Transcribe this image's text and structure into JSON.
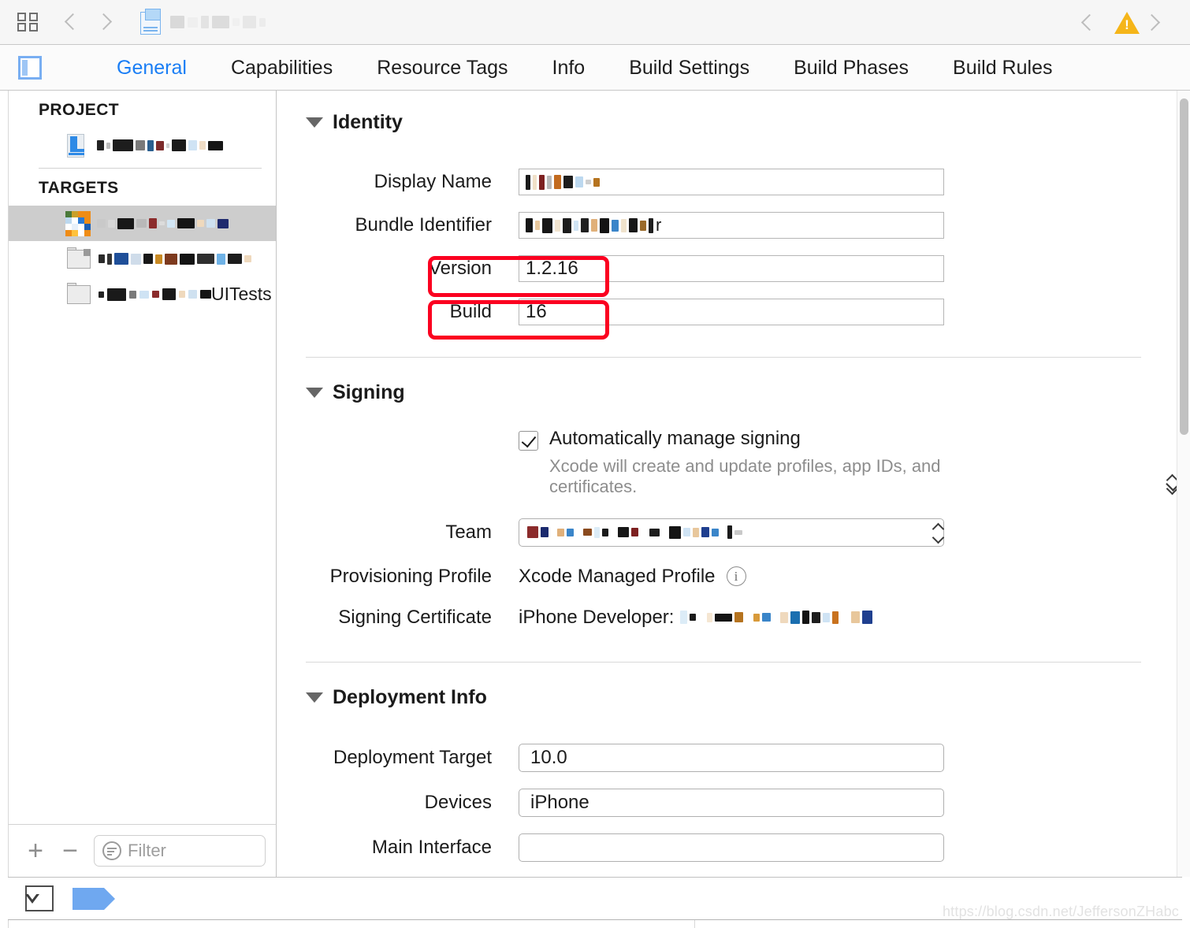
{
  "toolbar": {
    "grid_icon": "grid-icon",
    "back_label": "‹",
    "forward_label": "›",
    "breadcrumb_redacted": true,
    "warning_icon": "warning-triangle-icon"
  },
  "tabbar": {
    "sidebar_toggle": "sidebar-toggle-icon",
    "active_tab": "General",
    "tabs": [
      {
        "label": "General",
        "active": true
      },
      {
        "label": "Capabilities",
        "active": false
      },
      {
        "label": "Resource Tags",
        "active": false
      },
      {
        "label": "Info",
        "active": false
      },
      {
        "label": "Build Settings",
        "active": false
      },
      {
        "label": "Build Phases",
        "active": false
      },
      {
        "label": "Build Rules",
        "active": false
      }
    ]
  },
  "sidebar": {
    "project_header": "PROJECT",
    "targets_header": "TARGETS",
    "project_items": [
      {
        "name_visible": "",
        "redacted": true,
        "icon": "xcode-project-icon"
      }
    ],
    "target_items": [
      {
        "name_visible": "",
        "redacted": true,
        "icon": "app-icon",
        "selected": true
      },
      {
        "name_visible": "",
        "redacted": true,
        "icon": "test-bundle-icon",
        "selected": false
      },
      {
        "name_visible": "UITests",
        "redacted": true,
        "icon": "test-bundle-icon",
        "selected": false
      }
    ],
    "footer": {
      "add_label": "+",
      "remove_label": "−",
      "filter_placeholder": "Filter",
      "filter_value": ""
    }
  },
  "content": {
    "identity": {
      "title": "Identity",
      "fields": [
        {
          "label": "Display Name",
          "value": "",
          "redacted": true,
          "highlighted": false
        },
        {
          "label": "Bundle Identifier",
          "value": "",
          "redacted": true,
          "highlighted": false
        },
        {
          "label": "Version",
          "value": "1.2.16",
          "redacted": false,
          "highlighted": true
        },
        {
          "label": "Build",
          "value": "16",
          "redacted": false,
          "highlighted": true
        }
      ]
    },
    "signing": {
      "title": "Signing",
      "auto_manage_label": "Automatically manage signing",
      "auto_manage_checked": true,
      "hint": "Xcode will create and update profiles, app IDs, and certificates.",
      "team_label": "Team",
      "team_value": "",
      "team_redacted": true,
      "provisioning_profile_label": "Provisioning Profile",
      "provisioning_profile_value": "Xcode Managed Profile",
      "provisioning_info_icon": "info-icon",
      "signing_certificate_label": "Signing Certificate",
      "signing_certificate_value": "iPhone Developer:",
      "signing_certificate_redacted": true
    },
    "deployment": {
      "title": "Deployment Info",
      "deployment_target_label": "Deployment Target",
      "deployment_target_value": "10.0",
      "devices_label": "Devices",
      "devices_value": "iPhone",
      "main_interface_label": "Main Interface",
      "main_interface_value": ""
    }
  },
  "bottombar": {
    "filter_issues_icon": "filter-issues-icon",
    "breakpoint_icon": "breakpoint-flag-icon"
  },
  "watermark": "https://blog.csdn.net/JeffersonZHabc",
  "colors": {
    "accent_blue": "#1a7ef5",
    "highlight_red": "#fb0020",
    "warning_yellow": "#f5b519",
    "selected_row": "#cdcdcd"
  }
}
